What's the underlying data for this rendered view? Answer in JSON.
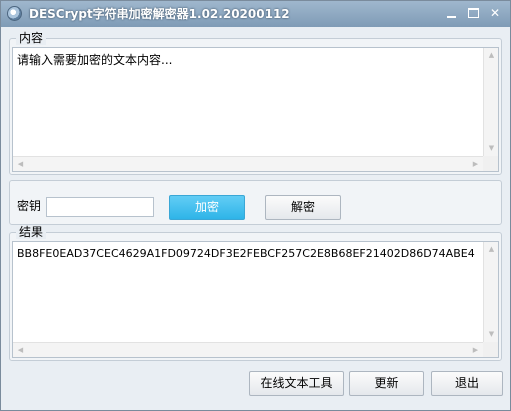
{
  "window": {
    "title": "DESCrypt字符串加密解密器1.02.20200112"
  },
  "content_group": {
    "legend": "内容",
    "text": "请输入需要加密的文本内容..."
  },
  "key_group": {
    "key_label": "密钥",
    "key_value": "",
    "encrypt_label": "加密",
    "decrypt_label": "解密"
  },
  "result_group": {
    "legend": "结果",
    "text": "BB8FE0EAD37CEC4629A1FD09724DF3E2FEBCF257C2E8B68EF21402D86D74ABE4"
  },
  "footer": {
    "online_tools_label": "在线文本工具",
    "update_label": "更新",
    "exit_label": "退出"
  },
  "colors": {
    "accent": "#2eb4e8",
    "titlebar": "#8aa6c0"
  },
  "icons": {
    "app": "app-icon",
    "minimize": "minimize-icon",
    "maximize": "maximize-icon",
    "close": "close-icon"
  }
}
